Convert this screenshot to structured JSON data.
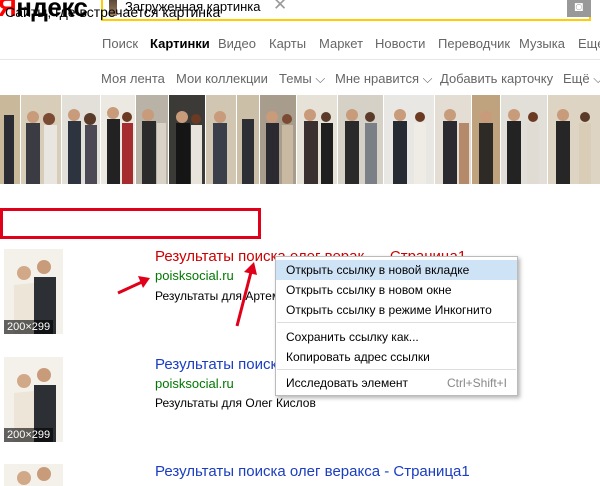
{
  "header": {
    "logo_first": "Я",
    "logo_rest": "ндекс",
    "search_value": "Загруженная картинка",
    "clear_glyph": "✕",
    "camera_glyph": "◙"
  },
  "services": [
    "Поиск",
    "Картинки",
    "Видео",
    "Карты",
    "Маркет",
    "Новости",
    "Переводчик",
    "Музыка",
    "Еще"
  ],
  "subnav": [
    "Моя лента",
    "Мои коллекции",
    "Темы ⌵",
    "Мне нравится ⌵",
    "Добавить карточку",
    "Ещё ⌵"
  ],
  "section_title": "Сайты, где встречается картинка",
  "results": [
    {
      "title": "Результаты поиска олег верак... - Страница1",
      "url": "poisksocial.ru",
      "desc": "Результаты для Артем",
      "size": "200×299"
    },
    {
      "title": "Результаты поиска",
      "url": "poisksocial.ru",
      "desc": "Результаты для Олег Кислов",
      "size": "200×299"
    },
    {
      "title": "Результаты поиска олег веракса - Страница1",
      "url": "",
      "desc": "",
      "size": ""
    }
  ],
  "context_menu": [
    {
      "label": "Открыть ссылку в новой вкладке",
      "shortcut": "",
      "highlighted": true
    },
    {
      "label": "Открыть ссылку в новом окне",
      "shortcut": ""
    },
    {
      "label": "Открыть ссылку в режиме Инкогнито",
      "shortcut": ""
    },
    {
      "label": "Сохранить ссылку как...",
      "shortcut": ""
    },
    {
      "label": "Копировать адрес ссылки",
      "shortcut": ""
    },
    {
      "label": "Исследовать элемент",
      "shortcut": "Ctrl+Shift+I"
    }
  ],
  "colors": {
    "accent_red": "#e0001a",
    "link_blue": "#1a3dc1",
    "url_green": "#007700",
    "search_border": "#fc0"
  }
}
